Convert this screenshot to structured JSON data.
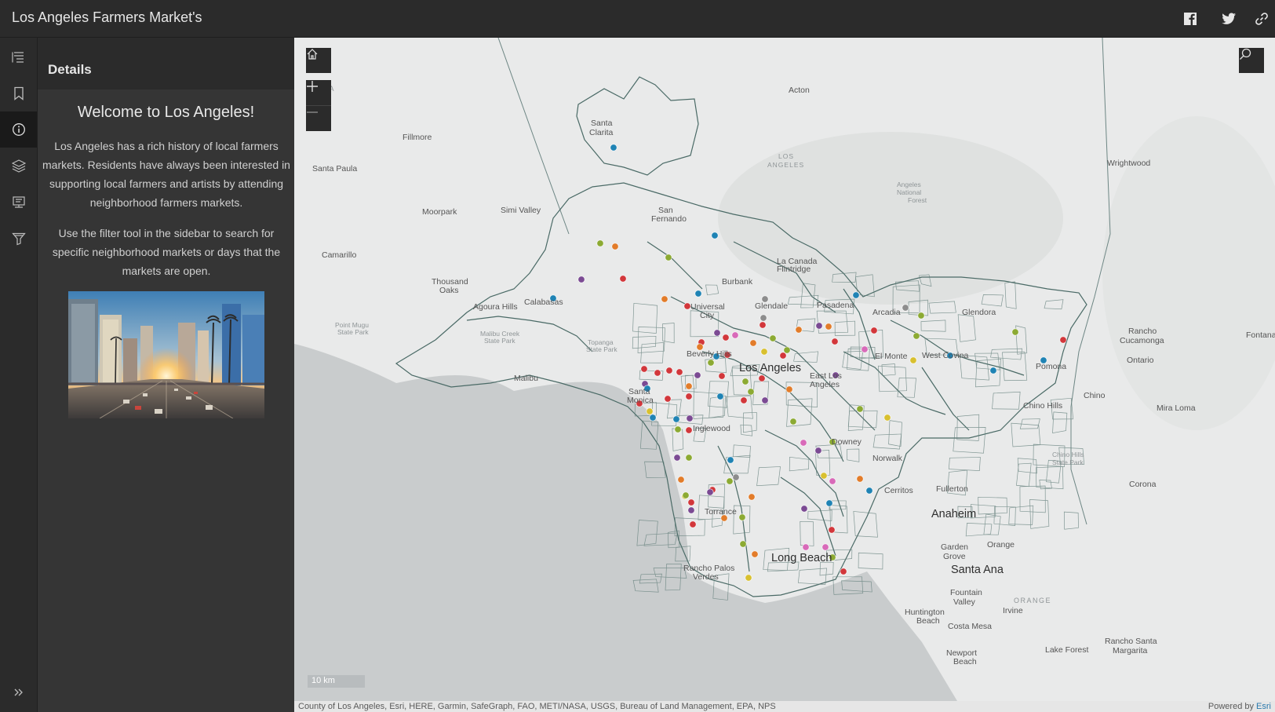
{
  "header": {
    "title": "Los Angeles Farmers Market's",
    "share_icons": [
      "facebook-icon",
      "twitter-icon",
      "link-icon"
    ]
  },
  "rail": {
    "items": [
      {
        "name": "legend",
        "icon": "legend-list-icon",
        "active": false
      },
      {
        "name": "bookmarks",
        "icon": "bookmark-icon",
        "active": false
      },
      {
        "name": "details",
        "icon": "info-icon",
        "active": true
      },
      {
        "name": "layers",
        "icon": "layers-icon",
        "active": false
      },
      {
        "name": "basemaps",
        "icon": "basemap-gallery-icon",
        "active": false
      },
      {
        "name": "filter",
        "icon": "filter-icon",
        "active": false
      }
    ],
    "expand_icon": "chevron-double-right-icon"
  },
  "panel": {
    "heading": "Details",
    "title": "Welcome to Los Angeles!",
    "paragraphs": [
      "Los Angeles has a rich history of local farmers markets. Residents have always been interested in supporting local farmers and artists by attending neighborhood farmers markets.",
      "Use the filter tool in the sidebar to search for specific neighborhood markets or days that the markets are open."
    ]
  },
  "map": {
    "controls": [
      "home-icon",
      "zoom-in-icon",
      "zoom-out-icon",
      "search-icon"
    ],
    "scale_label": "10 km",
    "labels": {
      "major": [
        "Los Angeles",
        "Long Beach",
        "Anaheim",
        "Santa Ana"
      ],
      "cities": [
        "Acton",
        "Santa Clarita",
        "Fillmore",
        "Santa Paula",
        "Wrightwood",
        "Moorpark",
        "Simi Valley",
        "San Fernando",
        "Camarillo",
        "La Canada Flintridge",
        "Burbank",
        "Thousand Oaks",
        "Agoura Hills",
        "Calabasas",
        "Universal City",
        "Glendale",
        "Pasadena",
        "Arcadia",
        "Glendora",
        "Rancho Cucamonga",
        "Fontana",
        "Beverly Hills",
        "El Monte",
        "West Covina",
        "Pomona",
        "Ontario",
        "Malibu",
        "Santa Monica",
        "East Los Angeles",
        "Chino",
        "Chino Hills",
        "Mira Loma",
        "Inglewood",
        "Downey",
        "Norwalk",
        "Cerritos",
        "Fullerton",
        "Corona",
        "Torrance",
        "Garden Grove",
        "Orange",
        "Rancho Palos Verdes",
        "Fountain Valley",
        "Irvine",
        "Huntington Beach",
        "Costa Mesa",
        "Newport Beach",
        "Lake Forest",
        "Rancho Santa Margarita"
      ],
      "parks": [
        "LOS ANGELES",
        "Angeles National Forest",
        "Point Mugu State Park",
        "Malibu Creek State Park",
        "Topanga State Park",
        "Chino Hills State Park",
        "ORANGE"
      ]
    },
    "market_colors": {
      "red": "#d2373b",
      "blue": "#1f83b4",
      "green": "#8caa33",
      "orange": "#e27c2a",
      "purple": "#7b4a93",
      "pink": "#d86ab9",
      "yellow": "#d8c02f",
      "gray": "#8d8d8d"
    }
  },
  "attribution": {
    "sources": "County of Los Angeles, Esri, HERE, Garmin, SafeGraph, FAO, METI/NASA, USGS, Bureau of Land Management, EPA, NPS",
    "powered_by": "Powered by",
    "esri": "Esri"
  }
}
